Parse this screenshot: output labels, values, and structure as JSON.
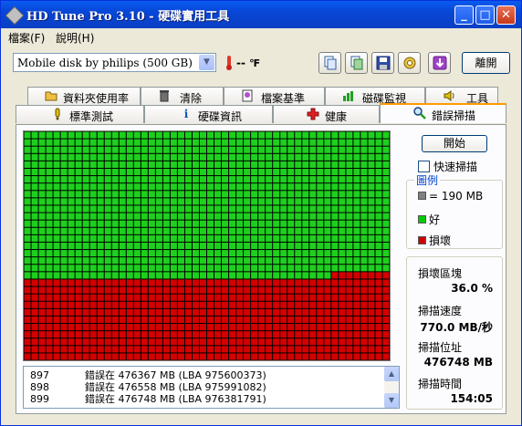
{
  "window": {
    "title": "HD Tune Pro 3.10 - 硬碟實用工具"
  },
  "title_buttons": {
    "minimize": "_",
    "maximize": "□",
    "close": "✕"
  },
  "menu": [
    "檔案(F)",
    "說明(H)"
  ],
  "toolbar": {
    "drive": "Mobile  disk by philips (500 GB)",
    "temperature": "-- ℉",
    "temp_display": "--",
    "exit_label": "離開",
    "icons": [
      "copy-text-icon",
      "copy-screenshot-icon",
      "save-icon",
      "options-icon",
      "download-icon"
    ]
  },
  "tabs_top": [
    {
      "label": "資料夾使用率",
      "icon": "folder-icon"
    },
    {
      "label": "清除",
      "icon": "trash-icon"
    },
    {
      "label": "檔案基準",
      "icon": "file-benchmark-icon"
    },
    {
      "label": "磁碟監視",
      "icon": "disk-monitor-icon"
    },
    {
      "label": "工具",
      "icon": "speaker-icon"
    }
  ],
  "tabs_bottom": [
    {
      "label": "標準測試",
      "icon": "benchmark-icon"
    },
    {
      "label": "硬碟資訊",
      "icon": "info-icon"
    },
    {
      "label": "健康",
      "icon": "health-cross-icon"
    },
    {
      "label": "錯誤掃描",
      "icon": "magnifier-icon",
      "active": true
    }
  ],
  "scan": {
    "start_label": "開始",
    "quick_scan_label": "快速掃描",
    "quick_scan_checked": false,
    "legend_title": "圖例",
    "legend": [
      {
        "label": "= 190 MB",
        "color": "#808080"
      },
      {
        "label": "好",
        "color": "#00cc00"
      },
      {
        "label": "損壞",
        "color": "#cc0000"
      }
    ],
    "grid": {
      "columns": 50,
      "rows": 31,
      "good_fraction": 0.64,
      "good_color": "#1ed01e",
      "bad_color": "#d40000"
    },
    "stats": [
      {
        "label": "損壞區塊",
        "value": "36.0 %"
      },
      {
        "label": "掃描速度",
        "value": "770.0 MB/秒"
      },
      {
        "label": "掃描位址",
        "value": "476748 MB"
      },
      {
        "label": "掃描時間",
        "value": "154:05"
      }
    ],
    "log": [
      {
        "num": "897",
        "text": "錯誤在 476367 MB (LBA 975600373)"
      },
      {
        "num": "898",
        "text": "錯誤在 476558 MB (LBA 975991082)"
      },
      {
        "num": "899",
        "text": "錯誤在 476748 MB (LBA 976381791)"
      }
    ]
  }
}
